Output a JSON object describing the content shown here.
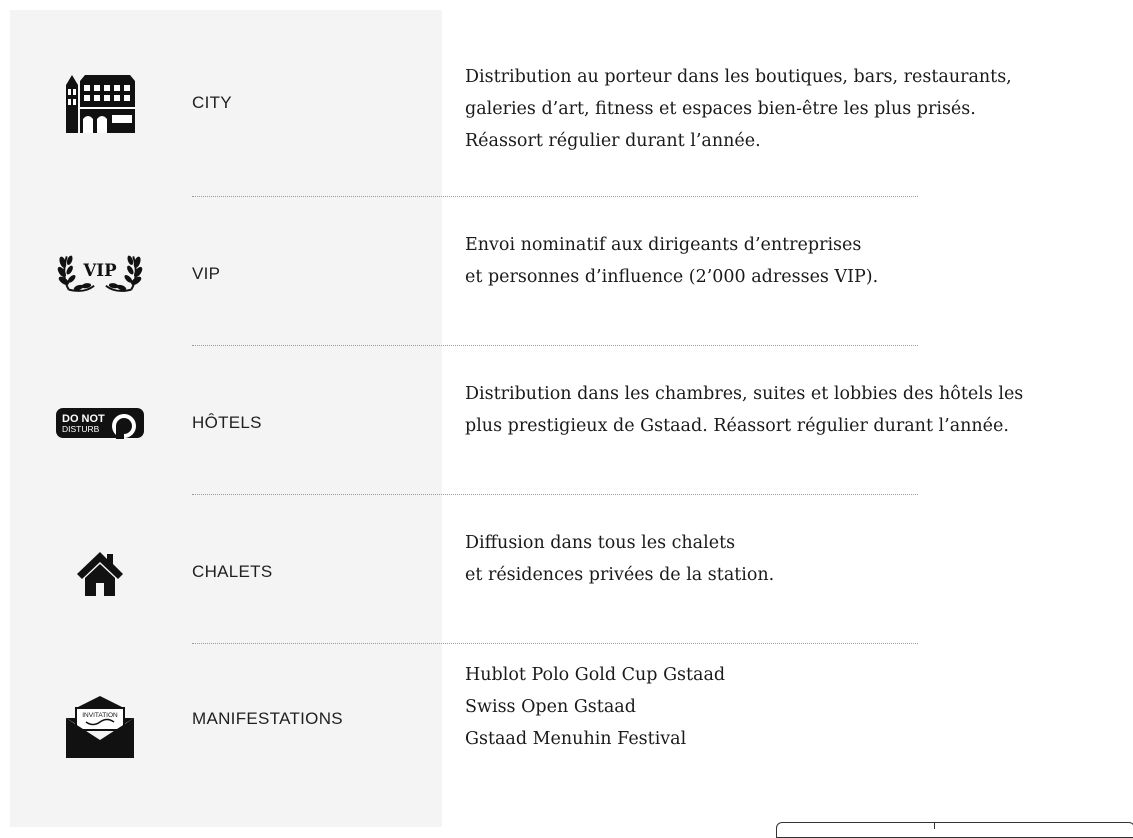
{
  "rows": [
    {
      "label": "CITY",
      "icon": "building-icon",
      "lines": [
        "Distribution au porteur dans les boutiques, bars, restaurants,",
        "galeries d’art, fitness et espaces bien-être les plus prisés.",
        "Réassort régulier durant l’année."
      ]
    },
    {
      "label": "VIP",
      "icon": "vip-laurel-icon",
      "icon_text": "VIP",
      "lines": [
        "Envoi nominatif aux dirigeants d’entreprises",
        "et personnes d’influence (2’000 adresses VIP)."
      ]
    },
    {
      "label": "HÔTELS",
      "icon": "do-not-disturb-icon",
      "icon_text_1": "DO NOT",
      "icon_text_2": "DISTURB",
      "lines": [
        "Distribution dans les chambres, suites et lobbies des hôtels les",
        "plus prestigieux de Gstaad. Réassort régulier durant l’année."
      ]
    },
    {
      "label": "CHALETS",
      "icon": "house-icon",
      "lines": [
        "Diffusion dans tous les chalets",
        "et résidences privées de la station."
      ]
    },
    {
      "label": "MANIFESTATIONS",
      "icon": "invitation-envelope-icon",
      "icon_text": "INVITATION",
      "lines": [
        "Hublot Polo Gold Cup Gstaad",
        "Swiss Open Gstaad",
        "Gstaad Menuhin Festival"
      ]
    }
  ]
}
